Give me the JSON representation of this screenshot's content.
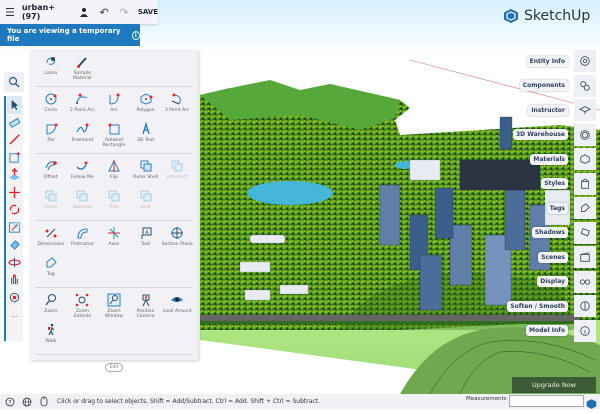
{
  "topbar": {
    "menu_icon": "hamburger-icon",
    "title": "urban+(97)",
    "user_icon": "user-add-icon",
    "undo_icon": "undo-icon",
    "redo_icon": "redo-icon",
    "save_label": "SAVE"
  },
  "banner": {
    "text": "You are viewing a temporary file",
    "icon": "info-icon"
  },
  "logo": {
    "text": "SketchUp"
  },
  "left_toolbar": {
    "search_icon": "search-icon",
    "tools": [
      "select",
      "eraser",
      "pencil",
      "rectangle",
      "push-pull",
      "move",
      "rotate",
      "scale",
      "paint-bucket",
      "orbit",
      "pan",
      "zoom-extents",
      "more"
    ],
    "more_label": "..."
  },
  "tool_panel": {
    "sections": [
      [
        {
          "label": "Lasso",
          "icon": "lasso"
        },
        {
          "label": "Sample Material",
          "icon": "eyedropper"
        }
      ],
      [
        {
          "label": "Circle",
          "icon": "circle"
        },
        {
          "label": "2 Point Arc",
          "icon": "arc2"
        },
        {
          "label": "Arc",
          "icon": "arc"
        },
        {
          "label": "Polygon",
          "icon": "polygon"
        },
        {
          "label": "3 Point Arc",
          "icon": "arc3"
        },
        {
          "label": "Pie",
          "icon": "pie"
        },
        {
          "label": "Freehand",
          "icon": "freehand"
        },
        {
          "label": "Rotated Rectangle",
          "icon": "rotrect"
        },
        {
          "label": "3D Text",
          "icon": "text3d"
        }
      ],
      [
        {
          "label": "Offset",
          "icon": "offset"
        },
        {
          "label": "Follow Me",
          "icon": "followme"
        },
        {
          "label": "Flip",
          "icon": "flip"
        },
        {
          "label": "Outer Shell",
          "icon": "shell"
        },
        {
          "label": "Intersect",
          "icon": "shell",
          "disabled": true
        },
        {
          "label": "Union",
          "icon": "shell",
          "disabled": true
        },
        {
          "label": "Subtract",
          "icon": "shell",
          "disabled": true
        },
        {
          "label": "Trim",
          "icon": "shell",
          "disabled": true
        },
        {
          "label": "Split",
          "icon": "shell",
          "disabled": true
        }
      ],
      [
        {
          "label": "Dimensions",
          "icon": "dimensions"
        },
        {
          "label": "Protractor",
          "icon": "protractor"
        },
        {
          "label": "Axes",
          "icon": "axes"
        },
        {
          "label": "Text",
          "icon": "text"
        },
        {
          "label": "Section Plane",
          "icon": "section"
        },
        {
          "label": "Tag",
          "icon": "tag"
        }
      ],
      [
        {
          "label": "Zoom",
          "icon": "zoom"
        },
        {
          "label": "Zoom Extents",
          "icon": "zoomext"
        },
        {
          "label": "Zoom Window",
          "icon": "zoomwin"
        },
        {
          "label": "Position Camera",
          "icon": "camera"
        },
        {
          "label": "Look Around",
          "icon": "eye"
        },
        {
          "label": "Walk",
          "icon": "walk"
        }
      ]
    ],
    "edit_label": "Edit"
  },
  "right_panel": [
    {
      "label": "Entity Info",
      "icon": "entity-info-icon"
    },
    {
      "label": "Components",
      "icon": "components-icon"
    },
    {
      "label": "Instructor",
      "icon": "instructor-icon"
    },
    {
      "label": "3D Warehouse",
      "icon": "warehouse-icon"
    },
    {
      "label": "Materials",
      "icon": "materials-icon"
    },
    {
      "label": "Styles",
      "icon": "styles-icon"
    },
    {
      "label": "Tags",
      "icon": "tags-icon"
    },
    {
      "label": "Shadows",
      "icon": "shadows-icon"
    },
    {
      "label": "Scenes",
      "icon": "scenes-icon"
    },
    {
      "label": "Display",
      "icon": "display-icon"
    },
    {
      "label": "Soften / Smooth",
      "icon": "soften-icon"
    },
    {
      "label": "Model Info",
      "icon": "model-info-icon"
    }
  ],
  "upgrade": {
    "label": "Upgrade Now"
  },
  "status": {
    "hint": "Click or drag to select objects. Shift = Add/Subtract. Ctrl = Add. Shift + Ctrl = Subtract.",
    "measurements_label": "Measurements",
    "measurements_value": ""
  },
  "colors": {
    "accent": "#1f79be",
    "upgrade_bg": "#3b5a35",
    "panel_bg": "#f2f2f6"
  }
}
